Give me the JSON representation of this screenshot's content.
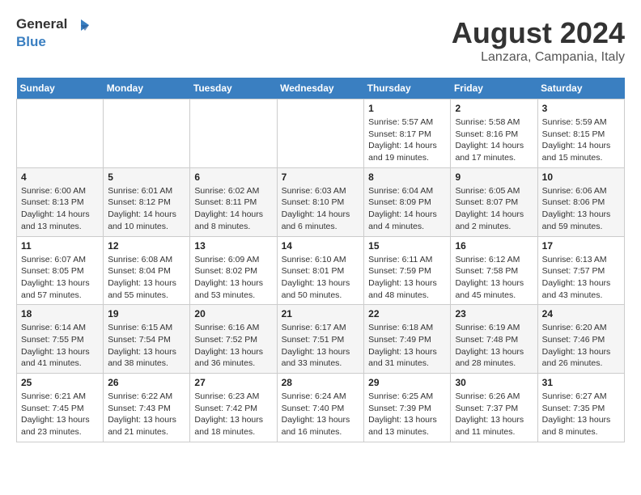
{
  "header": {
    "logo_line1": "General",
    "logo_line2": "Blue",
    "title": "August 2024",
    "subtitle": "Lanzara, Campania, Italy"
  },
  "days_of_week": [
    "Sunday",
    "Monday",
    "Tuesday",
    "Wednesday",
    "Thursday",
    "Friday",
    "Saturday"
  ],
  "weeks": [
    {
      "days": [
        {
          "num": "",
          "info": ""
        },
        {
          "num": "",
          "info": ""
        },
        {
          "num": "",
          "info": ""
        },
        {
          "num": "",
          "info": ""
        },
        {
          "num": "1",
          "info": "Sunrise: 5:57 AM\nSunset: 8:17 PM\nDaylight: 14 hours and 19 minutes."
        },
        {
          "num": "2",
          "info": "Sunrise: 5:58 AM\nSunset: 8:16 PM\nDaylight: 14 hours and 17 minutes."
        },
        {
          "num": "3",
          "info": "Sunrise: 5:59 AM\nSunset: 8:15 PM\nDaylight: 14 hours and 15 minutes."
        }
      ]
    },
    {
      "days": [
        {
          "num": "4",
          "info": "Sunrise: 6:00 AM\nSunset: 8:13 PM\nDaylight: 14 hours and 13 minutes."
        },
        {
          "num": "5",
          "info": "Sunrise: 6:01 AM\nSunset: 8:12 PM\nDaylight: 14 hours and 10 minutes."
        },
        {
          "num": "6",
          "info": "Sunrise: 6:02 AM\nSunset: 8:11 PM\nDaylight: 14 hours and 8 minutes."
        },
        {
          "num": "7",
          "info": "Sunrise: 6:03 AM\nSunset: 8:10 PM\nDaylight: 14 hours and 6 minutes."
        },
        {
          "num": "8",
          "info": "Sunrise: 6:04 AM\nSunset: 8:09 PM\nDaylight: 14 hours and 4 minutes."
        },
        {
          "num": "9",
          "info": "Sunrise: 6:05 AM\nSunset: 8:07 PM\nDaylight: 14 hours and 2 minutes."
        },
        {
          "num": "10",
          "info": "Sunrise: 6:06 AM\nSunset: 8:06 PM\nDaylight: 13 hours and 59 minutes."
        }
      ]
    },
    {
      "days": [
        {
          "num": "11",
          "info": "Sunrise: 6:07 AM\nSunset: 8:05 PM\nDaylight: 13 hours and 57 minutes."
        },
        {
          "num": "12",
          "info": "Sunrise: 6:08 AM\nSunset: 8:04 PM\nDaylight: 13 hours and 55 minutes."
        },
        {
          "num": "13",
          "info": "Sunrise: 6:09 AM\nSunset: 8:02 PM\nDaylight: 13 hours and 53 minutes."
        },
        {
          "num": "14",
          "info": "Sunrise: 6:10 AM\nSunset: 8:01 PM\nDaylight: 13 hours and 50 minutes."
        },
        {
          "num": "15",
          "info": "Sunrise: 6:11 AM\nSunset: 7:59 PM\nDaylight: 13 hours and 48 minutes."
        },
        {
          "num": "16",
          "info": "Sunrise: 6:12 AM\nSunset: 7:58 PM\nDaylight: 13 hours and 45 minutes."
        },
        {
          "num": "17",
          "info": "Sunrise: 6:13 AM\nSunset: 7:57 PM\nDaylight: 13 hours and 43 minutes."
        }
      ]
    },
    {
      "days": [
        {
          "num": "18",
          "info": "Sunrise: 6:14 AM\nSunset: 7:55 PM\nDaylight: 13 hours and 41 minutes."
        },
        {
          "num": "19",
          "info": "Sunrise: 6:15 AM\nSunset: 7:54 PM\nDaylight: 13 hours and 38 minutes."
        },
        {
          "num": "20",
          "info": "Sunrise: 6:16 AM\nSunset: 7:52 PM\nDaylight: 13 hours and 36 minutes."
        },
        {
          "num": "21",
          "info": "Sunrise: 6:17 AM\nSunset: 7:51 PM\nDaylight: 13 hours and 33 minutes."
        },
        {
          "num": "22",
          "info": "Sunrise: 6:18 AM\nSunset: 7:49 PM\nDaylight: 13 hours and 31 minutes."
        },
        {
          "num": "23",
          "info": "Sunrise: 6:19 AM\nSunset: 7:48 PM\nDaylight: 13 hours and 28 minutes."
        },
        {
          "num": "24",
          "info": "Sunrise: 6:20 AM\nSunset: 7:46 PM\nDaylight: 13 hours and 26 minutes."
        }
      ]
    },
    {
      "days": [
        {
          "num": "25",
          "info": "Sunrise: 6:21 AM\nSunset: 7:45 PM\nDaylight: 13 hours and 23 minutes."
        },
        {
          "num": "26",
          "info": "Sunrise: 6:22 AM\nSunset: 7:43 PM\nDaylight: 13 hours and 21 minutes."
        },
        {
          "num": "27",
          "info": "Sunrise: 6:23 AM\nSunset: 7:42 PM\nDaylight: 13 hours and 18 minutes."
        },
        {
          "num": "28",
          "info": "Sunrise: 6:24 AM\nSunset: 7:40 PM\nDaylight: 13 hours and 16 minutes."
        },
        {
          "num": "29",
          "info": "Sunrise: 6:25 AM\nSunset: 7:39 PM\nDaylight: 13 hours and 13 minutes."
        },
        {
          "num": "30",
          "info": "Sunrise: 6:26 AM\nSunset: 7:37 PM\nDaylight: 13 hours and 11 minutes."
        },
        {
          "num": "31",
          "info": "Sunrise: 6:27 AM\nSunset: 7:35 PM\nDaylight: 13 hours and 8 minutes."
        }
      ]
    }
  ]
}
